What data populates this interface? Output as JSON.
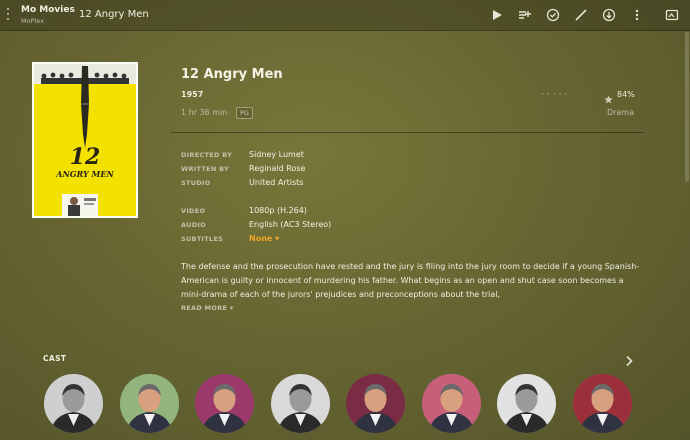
{
  "topbar": {
    "server_name": "Mo Movies",
    "server_sub": "MoPlex",
    "title": "12 Angry Men",
    "icons": [
      "play-icon",
      "add-to-queue-icon",
      "mark-watched-icon",
      "edit-icon",
      "download-icon",
      "more-icon",
      "cast-screen-icon"
    ]
  },
  "movie": {
    "title": "12 Angry Men",
    "year": "1957",
    "duration": "1 hr 36 min",
    "content_rating": "PG",
    "rating": "84%",
    "genre": "Drama",
    "poster": {
      "title_number": "12",
      "title_text": "ANGRY MEN"
    }
  },
  "metadata": [
    {
      "label": "DIRECTED BY",
      "value": "Sidney Lumet"
    },
    {
      "label": "WRITTEN BY",
      "value": "Reginald Rose"
    },
    {
      "label": "STUDIO",
      "value": "United Artists"
    },
    {
      "label": "VIDEO",
      "value": "1080p (H.264)"
    },
    {
      "label": "AUDIO",
      "value": "English (AC3 Stereo)"
    },
    {
      "label": "SUBTITLES",
      "value": "None ▾"
    }
  ],
  "summary": "The defense and the prosecution have rested and the jury is filing into the jury room to decide if a young Spanish-American is guilty or innocent of murdering his father. What begins as an open and shut case soon becomes a mini-drama of each of the jurors' prejudices and preconceptions about the trial,",
  "read_more": "READ MORE ▾",
  "cast": {
    "heading": "CAST",
    "members": [
      {
        "bg": "#cfcfcf",
        "tone": "bw"
      },
      {
        "bg": "#93b47c",
        "tone": "color"
      },
      {
        "bg": "#9b3a6a",
        "tone": "color"
      },
      {
        "bg": "#d9d9d9",
        "tone": "bw"
      },
      {
        "bg": "#7a2c44",
        "tone": "color"
      },
      {
        "bg": "#c75e7a",
        "tone": "color"
      },
      {
        "bg": "#e2e2e2",
        "tone": "bw"
      },
      {
        "bg": "#9b2f3c",
        "tone": "color"
      }
    ]
  },
  "colors": {
    "accent": "#f0a526",
    "poster_yellow": "#f3e200"
  }
}
